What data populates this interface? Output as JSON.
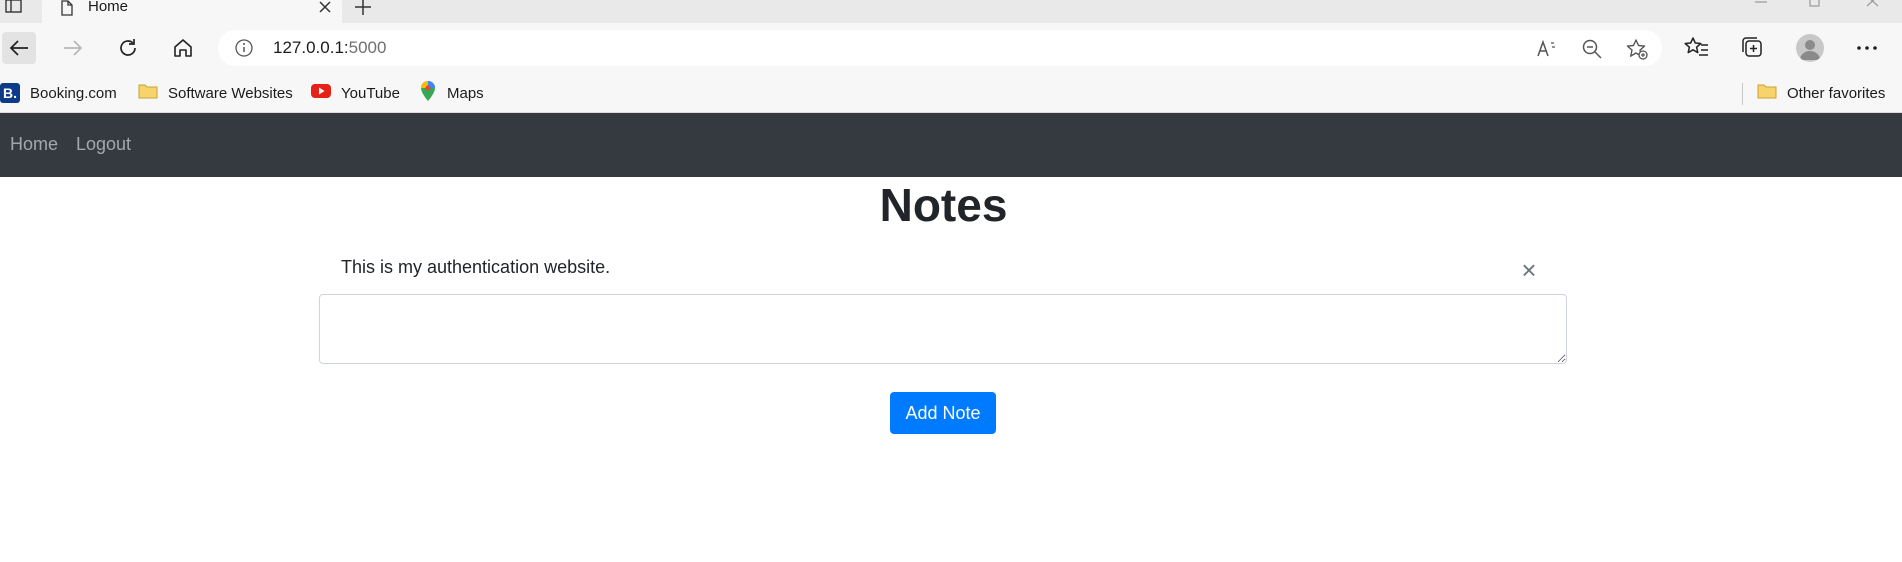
{
  "browser": {
    "tab": {
      "title": "Home",
      "icon": "document-icon"
    },
    "address": {
      "host": "127.0.0.1:",
      "port": "5000"
    },
    "favorites": [
      {
        "label": "Booking.com",
        "icon": "booking-icon",
        "icon_text": "B."
      },
      {
        "label": "Software Websites",
        "icon": "folder-icon"
      },
      {
        "label": "YouTube",
        "icon": "youtube-icon"
      },
      {
        "label": "Maps",
        "icon": "maps-icon"
      }
    ],
    "other_favorites": {
      "label": "Other favorites",
      "icon": "folder-icon"
    }
  },
  "navbar": {
    "background": "#343a40",
    "links": [
      {
        "label": "Home"
      },
      {
        "label": "Logout"
      }
    ]
  },
  "main": {
    "title": "Notes",
    "notes": [
      {
        "text": "This is my authentication website.",
        "delete_label": "×"
      }
    ],
    "note_input": {
      "value": "",
      "placeholder": ""
    },
    "add_button_label": "Add Note",
    "accent_color": "#007bff"
  }
}
